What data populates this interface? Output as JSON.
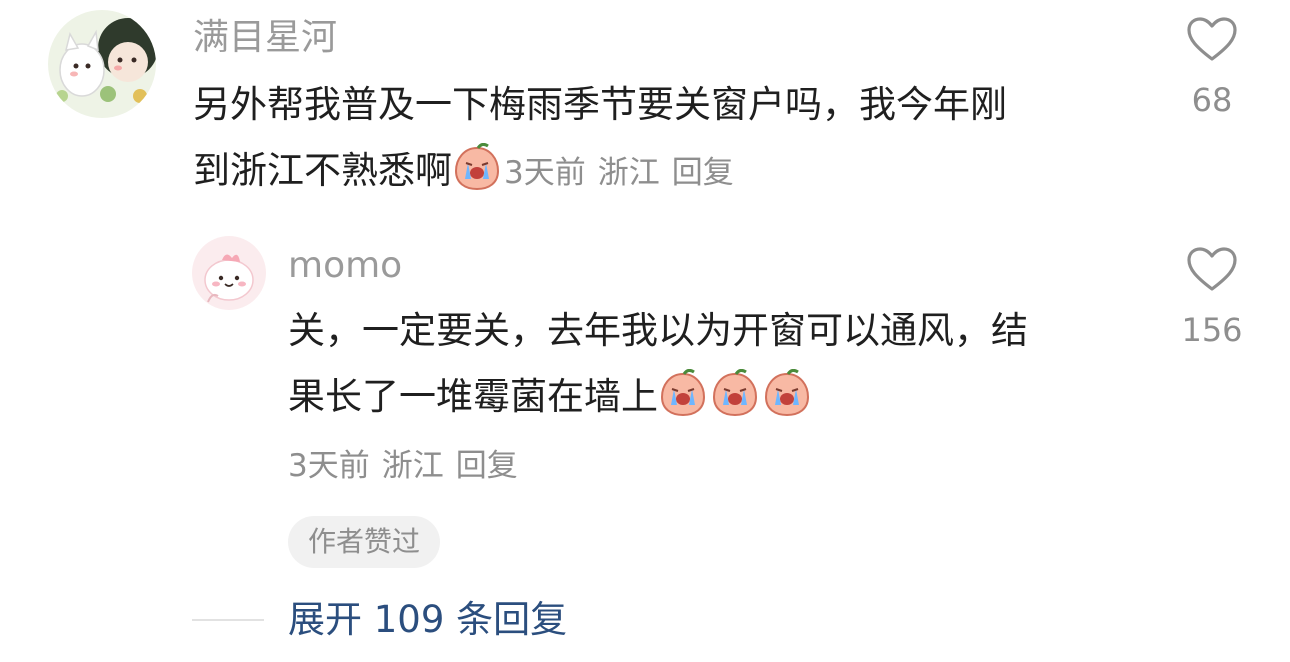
{
  "comments": [
    {
      "username": "满目星河",
      "text_line1": "另外帮我普及一下梅雨季节要关窗户吗，我今年刚",
      "text_line2": "到浙江不熟悉啊",
      "time": "3天前",
      "location": "浙江",
      "reply_label": "回复",
      "likes": "68",
      "emoji": "crying-emoji"
    },
    {
      "username": "momo",
      "text_line1": "关，一定要关，去年我以为开窗可以通风，结",
      "text_line2": "果长了一堆霉菌在墙上",
      "time": "3天前",
      "location": "浙江",
      "reply_label": "回复",
      "likes": "156",
      "badge": "作者赞过",
      "emoji": "crying-emoji"
    }
  ],
  "expand_label": "展开 109 条回复",
  "colors": {
    "text": "#1f1f1f",
    "secondary": "#8e8e8e",
    "link": "#2b4e7e",
    "badge_bg": "#f1f1f1"
  }
}
